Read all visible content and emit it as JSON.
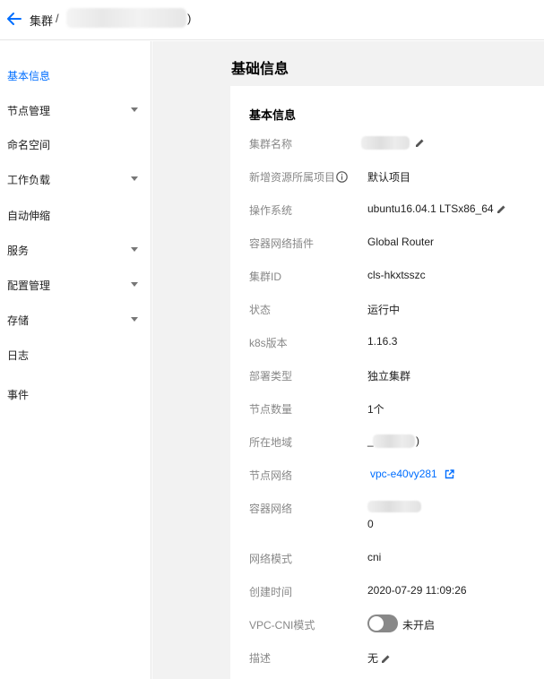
{
  "breadcrumb": {
    "root": "集群",
    "separator": "/",
    "end": ")"
  },
  "sidebar": {
    "items": [
      {
        "label": "基本信息",
        "active": true,
        "expandable": false
      },
      {
        "label": "节点管理",
        "active": false,
        "expandable": true
      },
      {
        "label": "命名空间",
        "active": false,
        "expandable": false
      },
      {
        "label": "工作负载",
        "active": false,
        "expandable": true
      },
      {
        "label": "自动伸缩",
        "active": false,
        "expandable": false
      },
      {
        "label": "服务",
        "active": false,
        "expandable": true
      },
      {
        "label": "配置管理",
        "active": false,
        "expandable": true
      },
      {
        "label": "存储",
        "active": false,
        "expandable": true
      },
      {
        "label": "日志",
        "active": false,
        "expandable": false
      },
      {
        "label": "事件",
        "active": false,
        "expandable": false
      }
    ]
  },
  "main": {
    "page_title": "基础信息",
    "card_title": "基本信息",
    "fields": {
      "cluster_name": {
        "label": "集群名称",
        "value": ""
      },
      "project": {
        "label": "新增资源所属项目",
        "value": "默认项目"
      },
      "os": {
        "label": "操作系统",
        "value": "ubuntu16.04.1 LTSx86_64"
      },
      "network_plugin": {
        "label": "容器网络插件",
        "value": "Global Router"
      },
      "cluster_id": {
        "label": "集群ID",
        "value": "cls-hkxtsszc"
      },
      "status": {
        "label": "状态",
        "value": "运行中"
      },
      "k8s_version": {
        "label": "k8s版本",
        "value": "1.16.3"
      },
      "deploy_type": {
        "label": "部署类型",
        "value": "独立集群"
      },
      "node_count": {
        "label": "节点数量",
        "value": "1个"
      },
      "region": {
        "label": "所在地域",
        "value_prefix": "_",
        "value_suffix": ")"
      },
      "node_network": {
        "label": "节点网络",
        "value": "vpc-e40vy281"
      },
      "container_network": {
        "label": "容器网络",
        "value_line2": "0"
      },
      "network_mode": {
        "label": "网络模式",
        "value": "cni"
      },
      "created": {
        "label": "创建时间",
        "value": "2020-07-29 11:09:26"
      },
      "vpc_cni": {
        "label": "VPC-CNI模式",
        "value": "未开启",
        "enabled": false
      },
      "description": {
        "label": "描述",
        "value": "无"
      }
    }
  },
  "colors": {
    "accent": "#006eff",
    "label": "#888888",
    "background": "#f2f2f2"
  },
  "icons": [
    "arrow-left-icon",
    "caret-down-icon",
    "pencil-icon",
    "info-icon",
    "external-link-icon"
  ]
}
